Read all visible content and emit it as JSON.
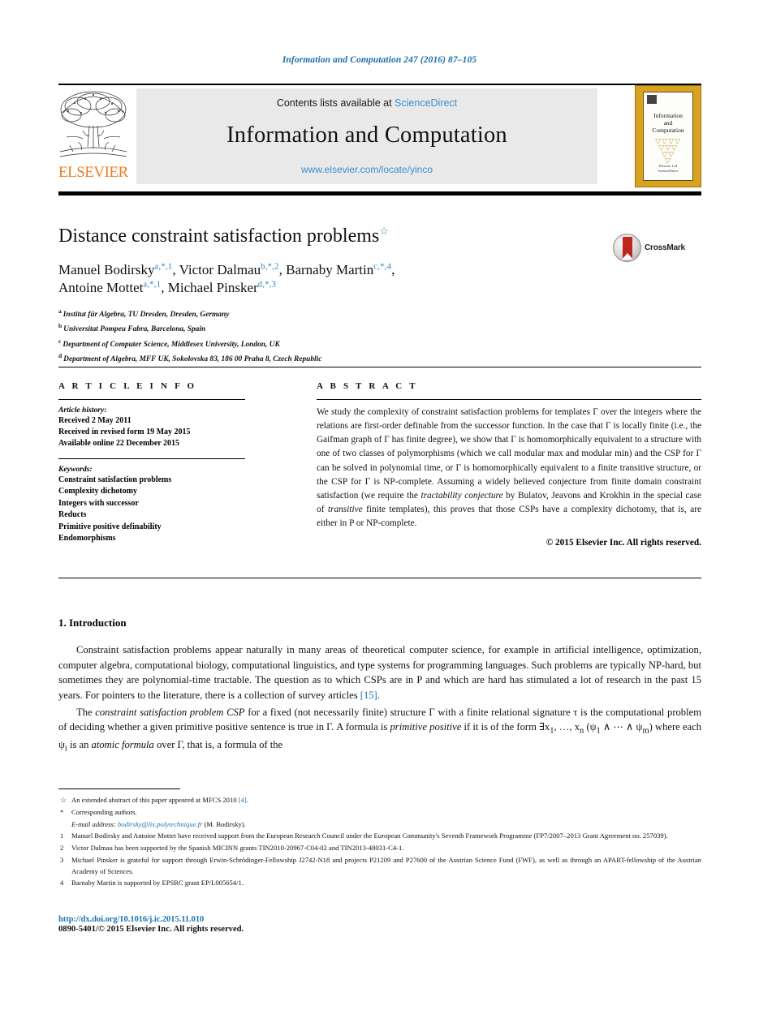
{
  "running_head": "Information and Computation 247 (2016) 87–105",
  "masthead": {
    "contents_prefix": "Contents lists available at ",
    "contents_link": "ScienceDirect",
    "journal_title": "Information and Computation",
    "journal_url": "www.elsevier.com/locate/yinco",
    "publisher_wordmark": "ELSEVIER",
    "cover": {
      "title_line1": "Information",
      "title_line2": "and",
      "title_line3": "Computation",
      "foot_line1": "Elsevier Ltd",
      "foot_line2": "ScienceDirect"
    }
  },
  "article": {
    "title": "Distance constraint satisfaction problems",
    "title_footnote_mark": "☆",
    "authors_line1": "Manuel Bodirsky",
    "authors_line1_marks": "a,*,1",
    "author2": "Victor Dalmau",
    "author2_marks": "b,*,2",
    "author3": "Barnaby Martin",
    "author3_marks": "c,*,4",
    "author4": "Antoine Mottet",
    "author4_marks": "a,*,1",
    "author5": "Michael Pinsker",
    "author5_marks": "d,*,3",
    "crossmark_label": "CrossMark",
    "affiliations": [
      {
        "mark": "a",
        "text": "Institut für Algebra, TU Dresden, Dresden, Germany"
      },
      {
        "mark": "b",
        "text": "Universitat Pompeu Fabra, Barcelona, Spain"
      },
      {
        "mark": "c",
        "text": "Department of Computer Science, Middlesex University, London, UK"
      },
      {
        "mark": "d",
        "text": "Department of Algebra, MFF UK, Sokolovska 83, 186 00 Praha 8, Czech Republic"
      }
    ]
  },
  "info": {
    "heading": "A R T I C L E    I N F O",
    "history_label": "Article history:",
    "history": [
      "Received 2 May 2011",
      "Received in revised form 19 May 2015",
      "Available online 22 December 2015"
    ],
    "keywords_label": "Keywords:",
    "keywords": [
      "Constraint satisfaction problems",
      "Complexity dichotomy",
      "Integers with successor",
      "Reducts",
      "Primitive positive definability",
      "Endomorphisms"
    ]
  },
  "abstract": {
    "heading": "A B S T R A C T",
    "paragraph_html": "We study the complexity of constraint satisfaction problems for templates Γ over the integers where the relations are first-order definable from the successor function. In the case that Γ is locally finite (i.e., the Gaifman graph of Γ has finite degree), we show that Γ is homomorphically equivalent to a structure with one of two classes of polymorphisms (which we call modular max and modular min) and the CSP for Γ can be solved in polynomial time, or Γ is homomorphically equivalent to a finite transitive structure, or the CSP for Γ is NP-complete. Assuming a widely believed conjecture from finite domain constraint satisfaction (we require the <i>tractability conjecture</i> by Bulatov, Jeavons and Krokhin in the special case of <i>transitive</i> finite templates), this proves that those CSPs have a complexity dichotomy, that is, are either in P or NP-complete.",
    "copyright": "© 2015 Elsevier Inc. All rights reserved."
  },
  "body": {
    "section_number_title": "1. Introduction",
    "paragraph1_html": "Constraint satisfaction problems appear naturally in many areas of theoretical computer science, for example in artificial intelligence, optimization, computer algebra, computational biology, computational linguistics, and type systems for programming languages. Such problems are typically NP-hard, but sometimes they are polynomial-time tractable. The question as to which CSPs are in P and which are hard has stimulated a lot of research in the past 15 years. For pointers to the literature, there is a collection of survey articles <span class=\"ref\">[15]</span>.",
    "paragraph2_html": "The <i>constraint satisfaction problem CSP</i> for a fixed (not necessarily finite) structure Γ with a finite relational signature τ is the computational problem of deciding whether a given primitive positive sentence is true in Γ. A formula is <i>primitive positive</i> if it is of the form ∃x<sub>1</sub>, …, x<sub>n</sub> (ψ<sub>1</sub> ∧ ⋯ ∧ ψ<sub>m</sub>) where each ψ<sub>i</sub> is an <i>atomic formula</i> over Γ, that is, a formula of the"
  },
  "footnotes": [
    {
      "mark": "☆",
      "text_html": "An extended abstract of this paper appeared at MFCS 2010 <span class=\"ref\">[4]</span>."
    },
    {
      "mark": "*",
      "text_html": "Corresponding authors."
    }
  ],
  "footnote_email": {
    "label": "E-mail address:",
    "address": "bodirsky@lix.polytechnique.fr",
    "owner": "(M. Bodirsky)."
  },
  "numbered_footnotes": [
    {
      "mark": "1",
      "text_html": "Manuel Bodirsky and Antoine Mottet have received support from the European Research Council under the European Community's Seventh Framework Programme (FP7/2007–2013 Grant Agreement no. 257039)."
    },
    {
      "mark": "2",
      "text_html": "Victor Dalmau has been supported by the Spanish MICINN grants TIN2010-20967-C04-02 and TIN2013-48031-C4-1."
    },
    {
      "mark": "3",
      "text_html": "Michael Pinsker is grateful for support through Erwin-Schrödinger-Fellowship J2742-N18 and projects P21209 and P27600 of the Austrian Science Fund (FWF), as well as through an APART-fellowship of the Austrian Academy of Sciences."
    },
    {
      "mark": "4",
      "text_html": "Barnaby Martin is supported by EPSRC grant EP/L005654/1."
    }
  ],
  "doi": {
    "url": "http://dx.doi.org/10.1016/j.ic.2015.11.010",
    "issn_line": "0890-5401/© 2015 Elsevier Inc. All rights reserved."
  },
  "colors": {
    "link": "#1c74b3",
    "sciencedirect": "#3a8fce",
    "elsevier_orange": "#eb7f25",
    "cover_gold": "#d7a320",
    "crossmark_red": "#c0271c"
  }
}
